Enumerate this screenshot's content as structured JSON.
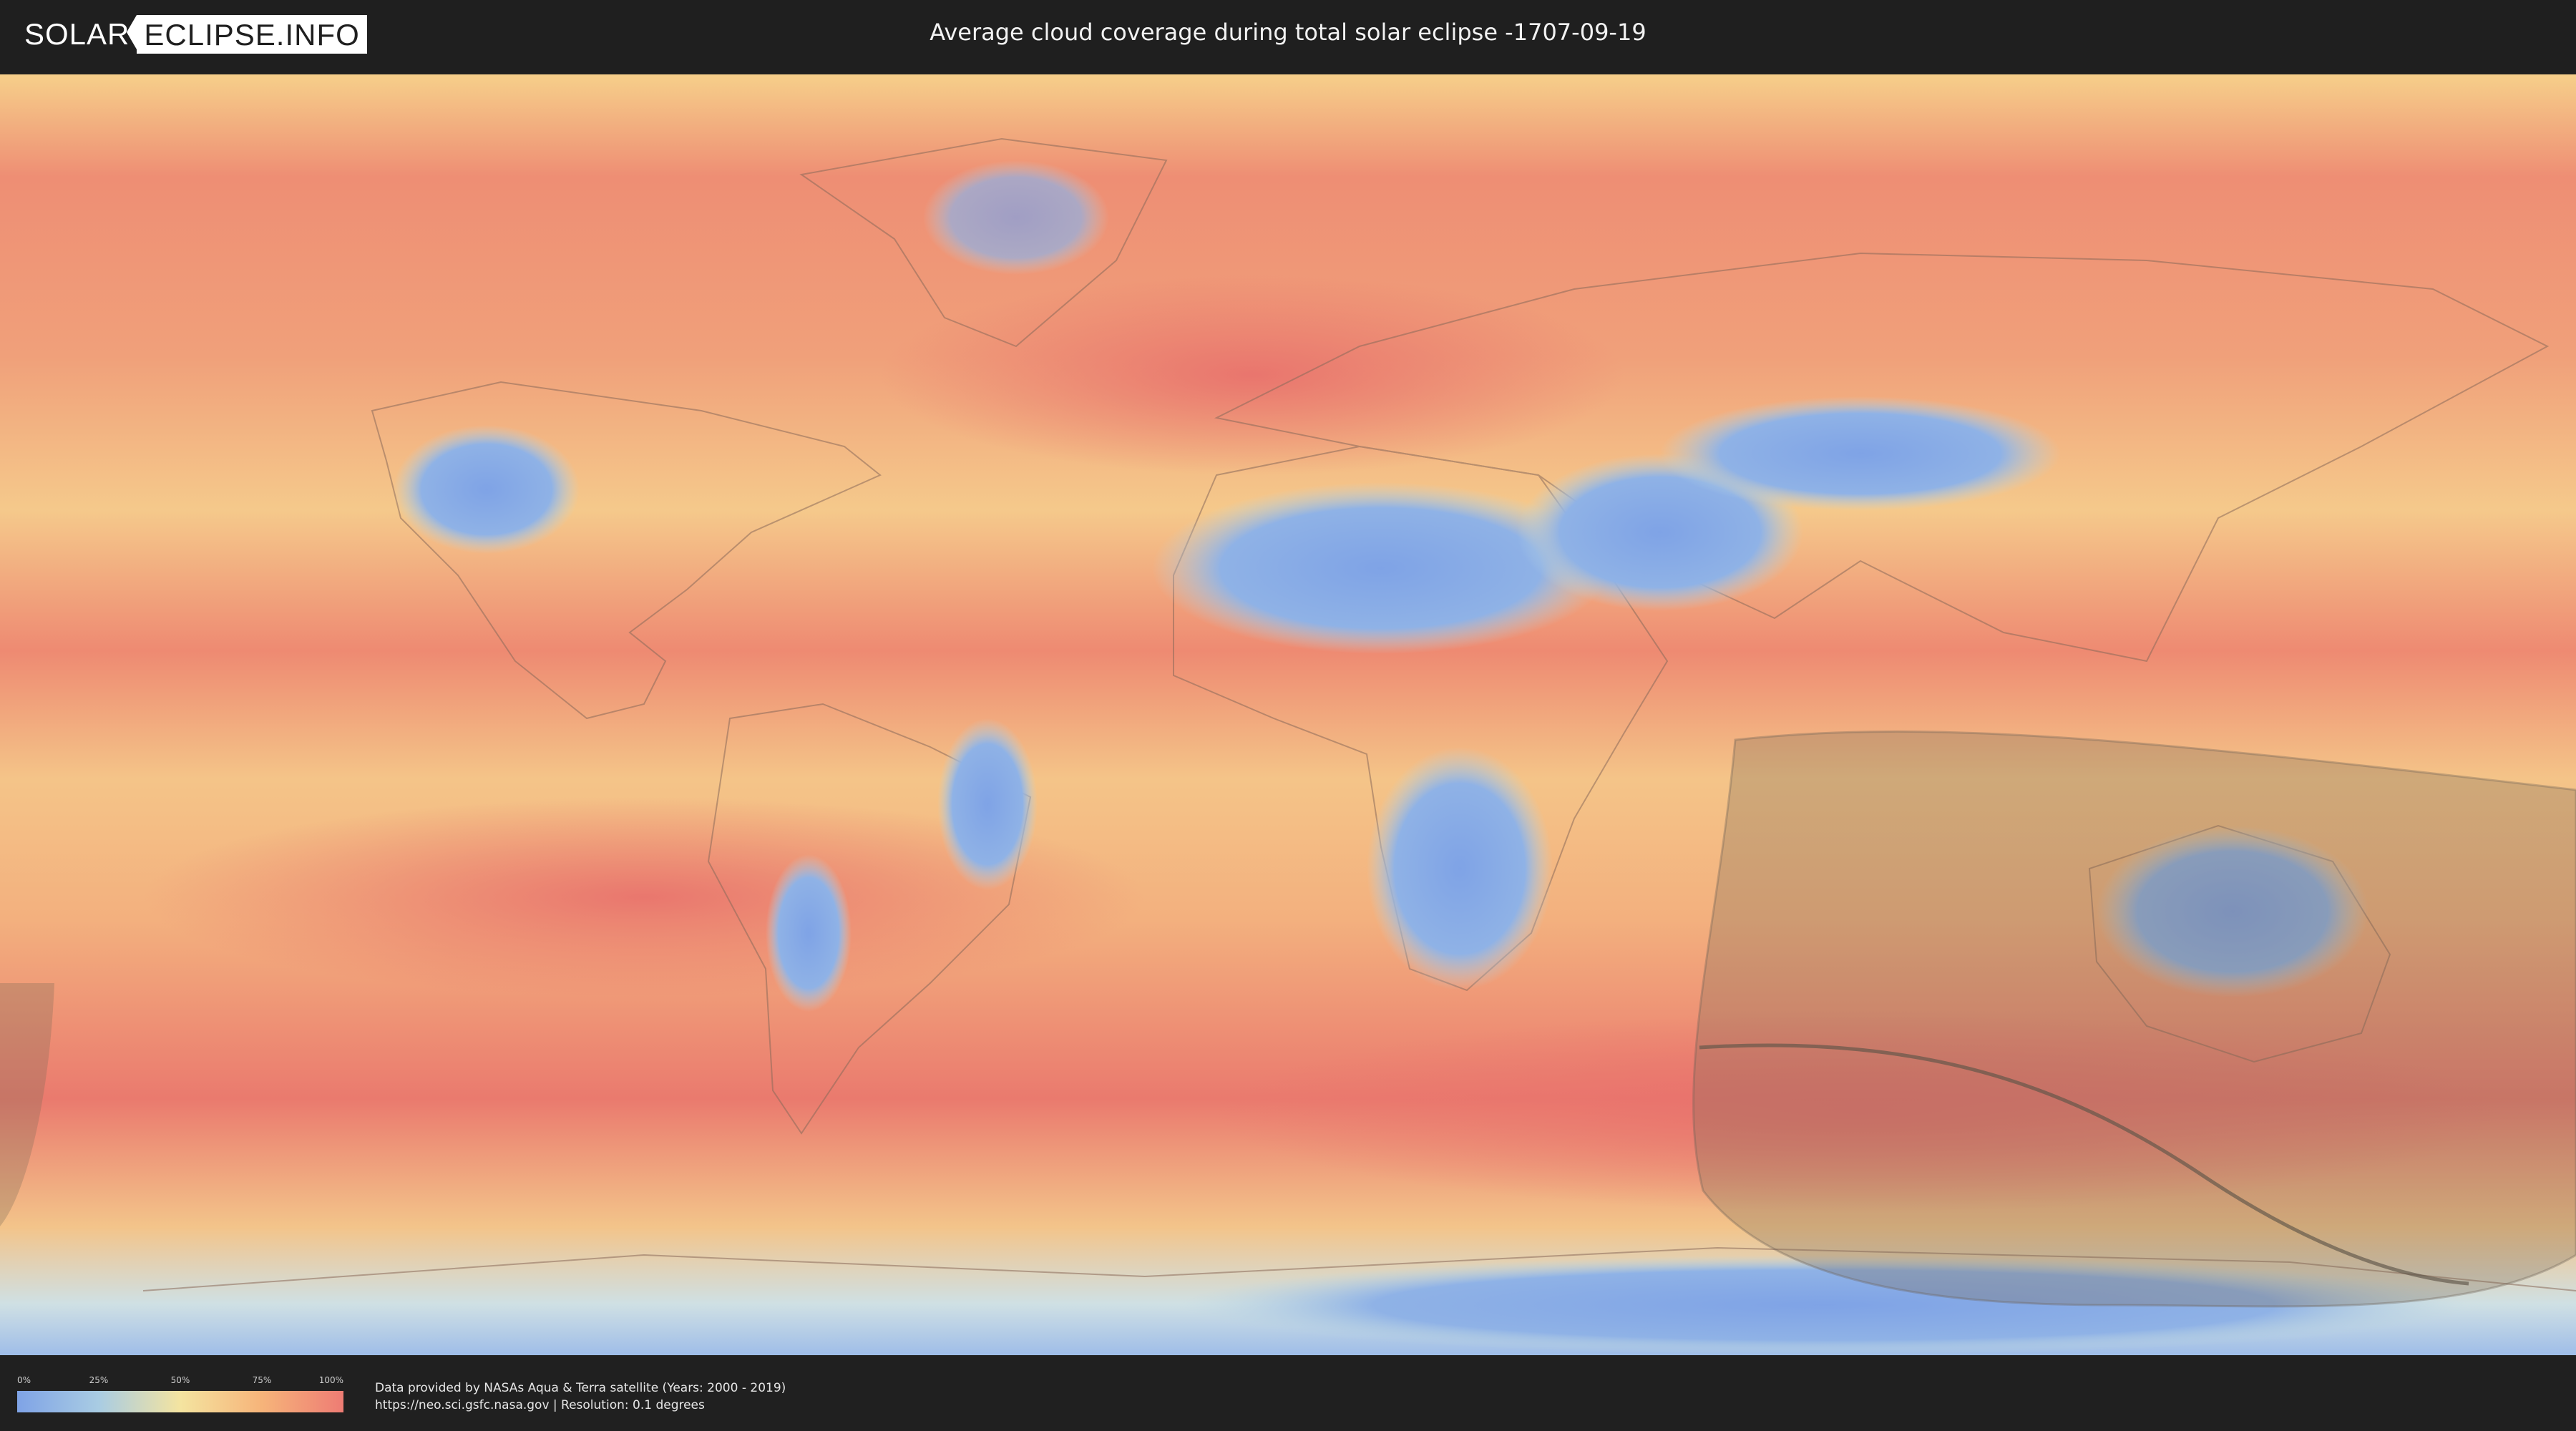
{
  "header": {
    "logo_left": "SOLAR",
    "logo_right": "ECLIPSE.INFO",
    "title": "Average cloud coverage during total solar eclipse -1707-09-19"
  },
  "legend": {
    "ticks": [
      "0%",
      "25%",
      "50%",
      "75%",
      "100%"
    ],
    "tick_values": [
      0,
      0.25,
      0.5,
      0.75,
      1.0
    ],
    "gradient_colors": [
      "#7fa3e6",
      "#a9cce3",
      "#f4e4a0",
      "#f6b47a",
      "#ee7c74"
    ]
  },
  "credits": {
    "line1": "Data provided by NASAs Aqua & Terra satellite (Years: 2000 - 2019)",
    "line2": "https://neo.sci.gsfc.nasa.gov | Resolution: 0.1 degrees"
  },
  "colors": {
    "clear_sky": "#7fa3e6",
    "mid_cloud": "#f4d38e",
    "cloudy": "#ea7a6e",
    "eclipse_shade": "#7a6a55",
    "eclipse_path": "#6e6255"
  }
}
